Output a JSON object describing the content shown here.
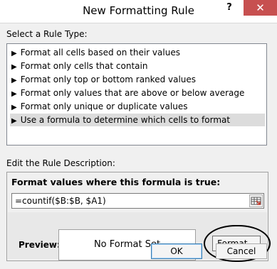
{
  "window": {
    "title": "New Formatting Rule",
    "help_label": "?",
    "close_label": "✕"
  },
  "rule_type": {
    "label": "Select a Rule Type:",
    "items": [
      {
        "label": "Format all cells based on their values"
      },
      {
        "label": "Format only cells that contain"
      },
      {
        "label": "Format only top or bottom ranked values"
      },
      {
        "label": "Format only values that are above or below average"
      },
      {
        "label": "Format only unique or duplicate values"
      },
      {
        "label": "Use a formula to determine which cells to format"
      }
    ],
    "selected_index": 5,
    "bullet": "▶"
  },
  "description": {
    "label": "Edit the Rule Description:",
    "heading": "Format values where this formula is true:",
    "formula": "=countif($B:$B, $A1)",
    "preview_label": "Preview:",
    "preview_text": "No Format Set",
    "format_button": "Format..."
  },
  "buttons": {
    "ok": "OK",
    "cancel": "Cancel"
  }
}
